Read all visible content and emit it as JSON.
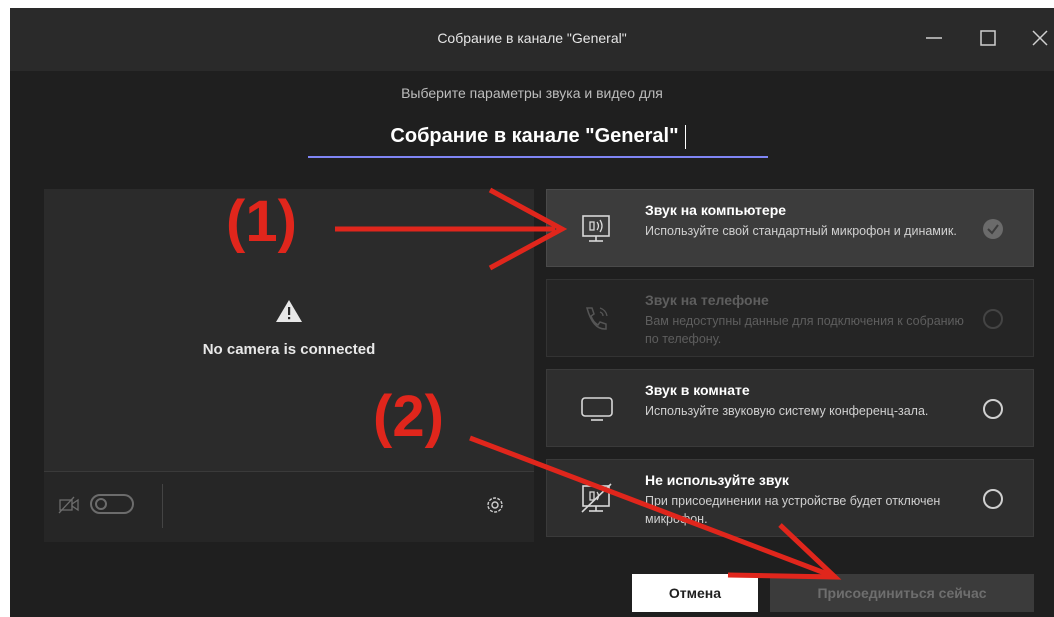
{
  "window": {
    "title": "Собрание в канале \"General\""
  },
  "header": {
    "subtitle": "Выберите параметры звука и видео для",
    "meeting_name": "Собрание в канале \"General\""
  },
  "preview": {
    "message": "No camera is connected"
  },
  "audio_options": [
    {
      "title": "Звук на компьютере",
      "description": "Используйте свой стандартный микрофон и динамик.",
      "icon": "computer-audio-icon",
      "state": "selected"
    },
    {
      "title": "Звук на телефоне",
      "description": "Вам недоступны данные для подключения к собранию по телефону.",
      "icon": "phone-audio-icon",
      "state": "disabled"
    },
    {
      "title": "Звук в комнате",
      "description": "Используйте звуковую систему конференц-зала.",
      "icon": "room-audio-icon",
      "state": "unselected"
    },
    {
      "title": "Не используйте звук",
      "description": "При присоединении на устройстве будет отключен микрофон.",
      "icon": "no-audio-icon",
      "state": "unselected"
    }
  ],
  "buttons": {
    "cancel": "Отмена",
    "join": "Присоединиться сейчас"
  },
  "annotations": {
    "first": "(1)",
    "second": "(2)"
  },
  "colors": {
    "annotation": "#e0261c",
    "accent_underline": "#7f85f5",
    "background": "#1f1f1f"
  }
}
